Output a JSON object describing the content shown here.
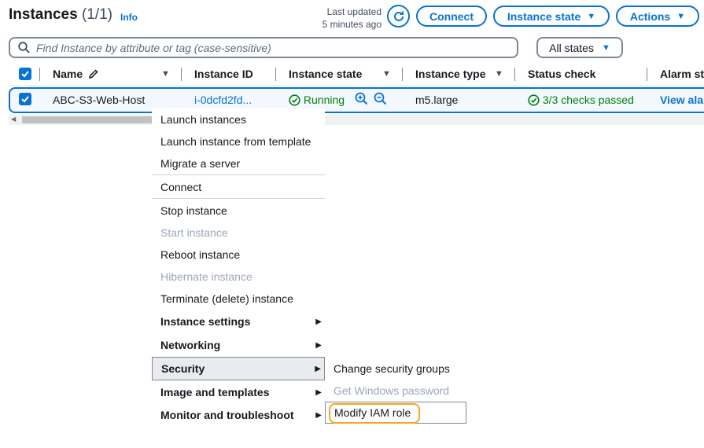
{
  "header": {
    "title": "Instances",
    "count": "(1/1)",
    "info": "Info",
    "last_updated_line1": "Last updated",
    "last_updated_line2": "5 minutes ago",
    "connect_label": "Connect",
    "instance_state_label": "Instance state",
    "actions_label": "Actions"
  },
  "search": {
    "placeholder": "Find Instance by attribute or tag (case-sensitive)",
    "state_filter": "All states"
  },
  "table": {
    "columns": [
      "Name",
      "Instance ID",
      "Instance state",
      "Instance type",
      "Status check",
      "Alarm st"
    ],
    "row": {
      "name": "ABC-S3-Web-Host",
      "instance_id": "i-0dcfd2fd...",
      "state": "Running",
      "type": "m5.large",
      "status_check": "3/3 checks passed",
      "alarm": "View ala"
    }
  },
  "menu": {
    "items": [
      {
        "label": "Launch instances"
      },
      {
        "label": "Launch instance from template"
      },
      {
        "label": "Migrate a server"
      },
      {
        "label": "Connect"
      },
      {
        "label": "Stop instance"
      },
      {
        "label": "Start instance",
        "disabled": true
      },
      {
        "label": "Reboot instance"
      },
      {
        "label": "Hibernate instance",
        "disabled": true
      },
      {
        "label": "Terminate (delete) instance"
      },
      {
        "label": "Instance settings",
        "submenu": true
      },
      {
        "label": "Networking",
        "submenu": true
      },
      {
        "label": "Security",
        "submenu": true
      },
      {
        "label": "Image and templates",
        "submenu": true
      },
      {
        "label": "Monitor and troubleshoot",
        "submenu": true
      }
    ],
    "security_submenu": [
      {
        "label": "Change security groups"
      },
      {
        "label": "Get Windows password",
        "disabled": true
      },
      {
        "label": "Modify IAM role"
      }
    ]
  },
  "colors": {
    "accent": "#0972d3",
    "success": "#037f0c",
    "highlight": "#f5a623"
  },
  "icons": [
    "refresh-icon",
    "search-icon",
    "pencil-icon",
    "check-circle-icon",
    "zoom-in-icon",
    "zoom-out-icon",
    "checkbox-checked-icon",
    "submenu-arrow-icon"
  ]
}
